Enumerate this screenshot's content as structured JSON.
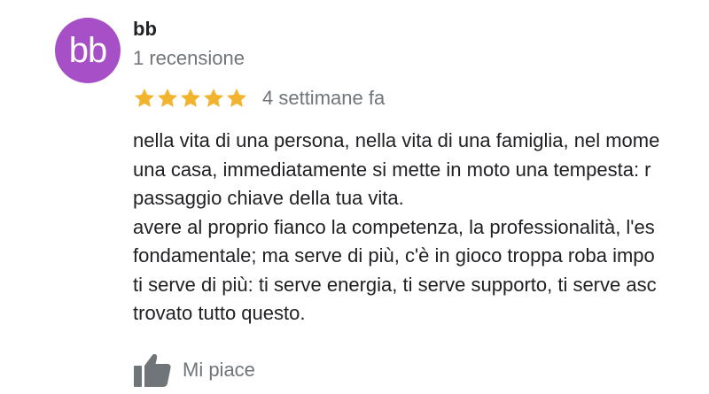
{
  "review": {
    "author": {
      "initials": "bb",
      "name": "bb",
      "review_count": "1 recensione",
      "avatar_color": "#a64fc6"
    },
    "rating": {
      "stars": 5,
      "max_stars": 5,
      "star_color": "#f2b42f",
      "date": "4 settimane fa"
    },
    "text_lines": [
      "nella vita di una persona, nella vita di una famiglia, nel mome",
      "una casa, immediatamente si mette in moto una tempesta: r",
      "passaggio chiave della tua vita.",
      "avere al proprio fianco la competenza, la professionalità, l'es",
      "fondamentale; ma serve di più, c'è in gioco troppa roba impo",
      "ti serve di più: ti serve energia, ti serve supporto, ti serve asc",
      "trovato tutto questo."
    ],
    "actions": {
      "like_label": "Mi piace",
      "like_icon": "thumbs-up-icon"
    }
  }
}
